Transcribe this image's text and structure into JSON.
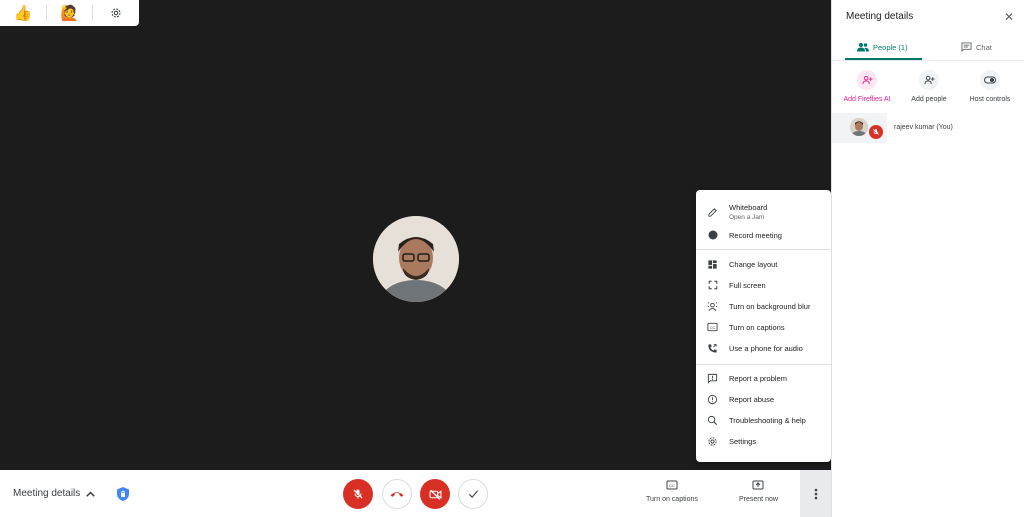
{
  "reactions": {
    "thumbs": "👍",
    "raise": "🙋"
  },
  "menu": {
    "whiteboard": "Whiteboard",
    "whiteboard_sub": "Open a Jam",
    "record": "Record meeting",
    "layout": "Change layout",
    "fullscreen": "Full screen",
    "blur": "Turn on background blur",
    "captions": "Turn on captions",
    "phone": "Use a phone for audio",
    "report_problem": "Report a problem",
    "report_abuse": "Report abuse",
    "help": "Troubleshooting & help",
    "settings": "Settings"
  },
  "panel": {
    "title": "Meeting details",
    "tab_people": "People (1)",
    "tab_chat": "Chat",
    "add_fireflies": "Add Fireflies AI",
    "add_people": "Add people",
    "host_controls": "Host controls",
    "person_name": "rajeev kumar (You)"
  },
  "bottom": {
    "meeting_details": "Meeting details",
    "captions": "Turn on captions",
    "present": "Present now"
  },
  "colors": {
    "accent": "#00796b",
    "danger": "#d93025",
    "fireflies": "#e91e8c"
  }
}
